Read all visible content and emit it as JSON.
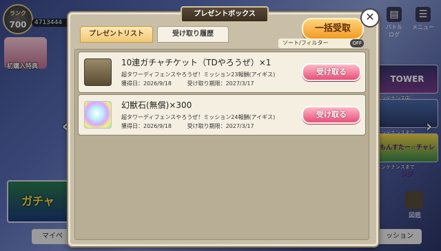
{
  "background": {
    "rank_label": "ランク",
    "rank_value": "700",
    "stamina": "4713444",
    "event_banner_label": "初購入特典",
    "gacha_banner_label": "ガチャ",
    "mypage_label": "マイペ",
    "top_buttons": [
      {
        "label": "バトルログ",
        "icon": "battle-log-icon"
      },
      {
        "label": "メニュー",
        "icon": "menu-icon"
      }
    ],
    "right_banners": [
      {
        "title": "TOWER",
        "status": "メンテナンス中"
      },
      {
        "title": "",
        "status": "メンテナンスまで"
      },
      {
        "title": "もんすたー☆チャレンジ",
        "status": "メンテナンスまで"
      }
    ],
    "mission_label": "ッション",
    "figure_label": "図鑑"
  },
  "dialog": {
    "title": "プレゼントボックス",
    "tabs": [
      {
        "label": "プレゼントリスト",
        "active": true
      },
      {
        "label": "受け取り履歴",
        "active": false
      }
    ],
    "bulk_receive_label": "一括受取",
    "sort_filter_label": "ソート/フィルター",
    "sort_filter_state": "OFF",
    "items": [
      {
        "name": "10連ガチャチケット（TDやろうぜ）×1",
        "source": "超タワーディフェンスやろうぜ！ミッション23報酬(アイギス)",
        "acquired": "獲得日：2026/9/18",
        "deadline": "受け取り期限：2027/3/17",
        "button_label": "受け取る",
        "icon": "ticket-icon"
      },
      {
        "name": "幻獣石(無償)×300",
        "source": "超タワーディフェンスやろうぜ！ミッション24報酬(アイギス)",
        "acquired": "獲得日：2026/9/18",
        "deadline": "受け取り期限：2027/3/17",
        "button_label": "受け取る",
        "icon": "crystal-icon"
      }
    ]
  },
  "colors": {
    "bulk_button": "#f39a24",
    "receive_button": "#e7507a",
    "dialog_bg": "#c9bfa9"
  }
}
